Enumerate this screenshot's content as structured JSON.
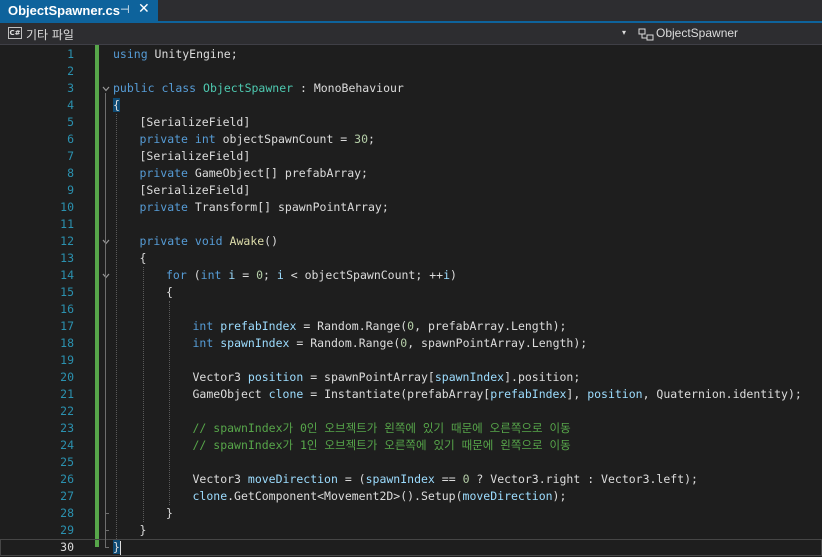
{
  "tab": {
    "title": "ObjectSpawner.cs",
    "pin_glyph": "⊣",
    "close_glyph": "✕"
  },
  "navbar": {
    "project_icon_text": "C#",
    "project_label": "기타 파일",
    "class_label": "ObjectSpawner",
    "dropdown_glyph": "▾"
  },
  "colors": {
    "accent": "#0e639c",
    "keyword": "#569cd6",
    "type": "#4ec9b0",
    "method": "#dcdcaa",
    "parameter": "#9cdcfe",
    "number": "#b5cea8",
    "comment": "#57a64a",
    "line_number": "#2b91af",
    "change_bar": "#57a64a"
  },
  "current_line": 30,
  "lines": [
    {
      "n": 1,
      "indent": 0,
      "tokens": [
        [
          "kw",
          "using"
        ],
        [
          "pl",
          " UnityEngine;"
        ]
      ]
    },
    {
      "n": 2,
      "indent": 0,
      "tokens": []
    },
    {
      "n": 3,
      "indent": 0,
      "tokens": [
        [
          "kw",
          "public"
        ],
        [
          "pl",
          " "
        ],
        [
          "kw",
          "class"
        ],
        [
          "pl",
          " "
        ],
        [
          "ty",
          "ObjectSpawner"
        ],
        [
          "pl",
          " : MonoBehaviour"
        ]
      ]
    },
    {
      "n": 4,
      "indent": 0,
      "tokens": [
        [
          "hl",
          "{"
        ]
      ]
    },
    {
      "n": 5,
      "indent": 1,
      "tokens": [
        [
          "pl",
          "[SerializeField]"
        ]
      ]
    },
    {
      "n": 6,
      "indent": 1,
      "tokens": [
        [
          "kw",
          "private"
        ],
        [
          "pl",
          " "
        ],
        [
          "kw",
          "int"
        ],
        [
          "pl",
          " objectSpawnCount = "
        ],
        [
          "nm",
          "30"
        ],
        [
          "pl",
          ";"
        ]
      ]
    },
    {
      "n": 7,
      "indent": 1,
      "tokens": [
        [
          "pl",
          "[SerializeField]"
        ]
      ]
    },
    {
      "n": 8,
      "indent": 1,
      "tokens": [
        [
          "kw",
          "private"
        ],
        [
          "pl",
          " GameObject[] prefabArray;"
        ]
      ]
    },
    {
      "n": 9,
      "indent": 1,
      "tokens": [
        [
          "pl",
          "[SerializeField]"
        ]
      ]
    },
    {
      "n": 10,
      "indent": 1,
      "tokens": [
        [
          "kw",
          "private"
        ],
        [
          "pl",
          " Transform[] spawnPointArray;"
        ]
      ]
    },
    {
      "n": 11,
      "indent": 0,
      "tokens": []
    },
    {
      "n": 12,
      "indent": 1,
      "tokens": [
        [
          "kw",
          "private"
        ],
        [
          "pl",
          " "
        ],
        [
          "kw",
          "void"
        ],
        [
          "pl",
          " "
        ],
        [
          "fn",
          "Awake"
        ],
        [
          "pl",
          "()"
        ]
      ]
    },
    {
      "n": 13,
      "indent": 1,
      "tokens": [
        [
          "pl",
          "{"
        ]
      ]
    },
    {
      "n": 14,
      "indent": 2,
      "tokens": [
        [
          "kw",
          "for"
        ],
        [
          "pl",
          " ("
        ],
        [
          "kw",
          "int"
        ],
        [
          "pl",
          " "
        ],
        [
          "pm",
          "i"
        ],
        [
          "pl",
          " = "
        ],
        [
          "nm",
          "0"
        ],
        [
          "pl",
          "; "
        ],
        [
          "pm",
          "i"
        ],
        [
          "pl",
          " < objectSpawnCount; ++"
        ],
        [
          "pm",
          "i"
        ],
        [
          "pl",
          ")"
        ]
      ]
    },
    {
      "n": 15,
      "indent": 2,
      "tokens": [
        [
          "pl",
          "{"
        ]
      ]
    },
    {
      "n": 16,
      "indent": 0,
      "tokens": []
    },
    {
      "n": 17,
      "indent": 3,
      "tokens": [
        [
          "kw",
          "int"
        ],
        [
          "pl",
          " "
        ],
        [
          "pm",
          "prefabIndex"
        ],
        [
          "pl",
          " = Random.Range("
        ],
        [
          "nm",
          "0"
        ],
        [
          "pl",
          ", prefabArray.Length);"
        ]
      ]
    },
    {
      "n": 18,
      "indent": 3,
      "tokens": [
        [
          "kw",
          "int"
        ],
        [
          "pl",
          " "
        ],
        [
          "pm",
          "spawnIndex"
        ],
        [
          "pl",
          " = Random.Range("
        ],
        [
          "nm",
          "0"
        ],
        [
          "pl",
          ", spawnPointArray.Length);"
        ]
      ]
    },
    {
      "n": 19,
      "indent": 0,
      "tokens": []
    },
    {
      "n": 20,
      "indent": 3,
      "tokens": [
        [
          "pl",
          "Vector3 "
        ],
        [
          "pm",
          "position"
        ],
        [
          "pl",
          " = spawnPointArray["
        ],
        [
          "pm",
          "spawnIndex"
        ],
        [
          "pl",
          "].position;"
        ]
      ]
    },
    {
      "n": 21,
      "indent": 3,
      "tokens": [
        [
          "pl",
          "GameObject "
        ],
        [
          "pm",
          "clone"
        ],
        [
          "pl",
          " = Instantiate(prefabArray["
        ],
        [
          "pm",
          "prefabIndex"
        ],
        [
          "pl",
          "], "
        ],
        [
          "pm",
          "position"
        ],
        [
          "pl",
          ", Quaternion.identity);"
        ]
      ]
    },
    {
      "n": 22,
      "indent": 0,
      "tokens": []
    },
    {
      "n": 23,
      "indent": 3,
      "tokens": [
        [
          "cm",
          "// spawnIndex가 0인 오브젝트가 왼쪽에 있기 때문에 오른쪽으로 이동"
        ]
      ]
    },
    {
      "n": 24,
      "indent": 3,
      "tokens": [
        [
          "cm",
          "// spawnIndex가 1인 오브젝트가 오른쪽에 있기 때문에 왼쪽으로 이동"
        ]
      ]
    },
    {
      "n": 25,
      "indent": 0,
      "tokens": []
    },
    {
      "n": 26,
      "indent": 3,
      "tokens": [
        [
          "pl",
          "Vector3 "
        ],
        [
          "pm",
          "moveDirection"
        ],
        [
          "pl",
          " = ("
        ],
        [
          "pm",
          "spawnIndex"
        ],
        [
          "pl",
          " == "
        ],
        [
          "nm",
          "0"
        ],
        [
          "pl",
          " ? Vector3.right : Vector3.left);"
        ]
      ]
    },
    {
      "n": 27,
      "indent": 3,
      "tokens": [
        [
          "pm",
          "clone"
        ],
        [
          "pl",
          ".GetComponent<Movement2D>().Setup("
        ],
        [
          "pm",
          "moveDirection"
        ],
        [
          "pl",
          ");"
        ]
      ]
    },
    {
      "n": 28,
      "indent": 2,
      "tokens": [
        [
          "pl",
          "}"
        ]
      ]
    },
    {
      "n": 29,
      "indent": 1,
      "tokens": [
        [
          "pl",
          "}"
        ]
      ]
    },
    {
      "n": 30,
      "indent": 0,
      "tokens": [
        [
          "hl",
          "}"
        ]
      ]
    }
  ]
}
